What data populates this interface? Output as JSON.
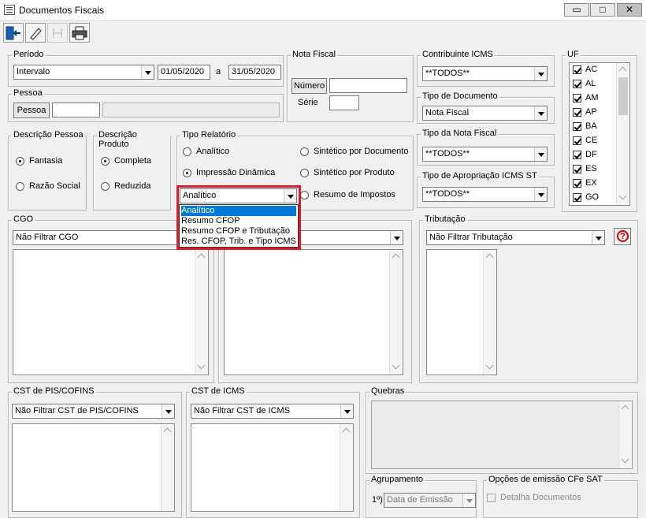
{
  "window": {
    "title": "Documentos Fiscais",
    "min": "▭",
    "restore": "□",
    "close": "✕"
  },
  "periodo": {
    "legend": "Período",
    "tipo": "Intervalo",
    "inicio": "01/05/2020",
    "sep": "a",
    "fim": "31/05/2020"
  },
  "pessoa": {
    "legend": "Pessoa",
    "button": "Pessoa",
    "codigo": "",
    "nome": ""
  },
  "nota_fiscal": {
    "legend": "Nota Fiscal",
    "numero_button": "Número",
    "numero": "",
    "serie_label": "Série",
    "serie": ""
  },
  "contribuinte": {
    "legend": "Contribuinte ICMS",
    "value": "**TODOS**"
  },
  "tipo_documento": {
    "legend": "Tipo de Documento",
    "value": "Nota Fiscal"
  },
  "tipo_nota": {
    "legend": "Tipo da Nota Fiscal",
    "value": "**TODOS**"
  },
  "apropriacao": {
    "legend": "Tipo de Apropriação ICMS ST",
    "value": "**TODOS**"
  },
  "uf": {
    "legend": "UF",
    "items": [
      "AC",
      "AL",
      "AM",
      "AP",
      "BA",
      "CE",
      "DF",
      "ES",
      "EX",
      "GO"
    ]
  },
  "descricao_pessoa": {
    "legend": "Descrição Pessoa",
    "options": [
      "Fantasia",
      "Razão Social"
    ]
  },
  "descricao_produto": {
    "legend": "Descrição Produto",
    "options": [
      "Completa",
      "Reduzida"
    ]
  },
  "tipo_relatorio": {
    "legend": "Tipo Relatório",
    "left_options": [
      "Analítico",
      "Impressão Dinâmica"
    ],
    "right_options": [
      "Sintético por Documento",
      "Sintético por Produto",
      "Resumo de Impostos"
    ],
    "combo_value": "Analítico",
    "dropdown": [
      "Analítico",
      "Resumo CFOP",
      "Resumo CFOP e Tributação",
      "Res. CFOP, Trib. e Tipo ICMS"
    ]
  },
  "cgo": {
    "legend": "CGO",
    "value": "Não Filtrar CGO"
  },
  "tributacao": {
    "legend": "Tributação",
    "value": "Não Filtrar Tributação",
    "help": "?"
  },
  "cst_pis": {
    "legend": "CST de PIS/COFINS",
    "value": "Não Filtrar CST de PIS/COFINS"
  },
  "cst_icms": {
    "legend": "CST de ICMS",
    "value": "Não Filtrar CST de ICMS"
  },
  "quebras": {
    "legend": "Quebras"
  },
  "agrupamento": {
    "legend": "Agrupamento",
    "prefix": "1º)",
    "value": "Data de Emissão"
  },
  "opcoes_sat": {
    "legend": "Opções de emissão CFe SAT",
    "detalha": "Detalha Documentos"
  }
}
